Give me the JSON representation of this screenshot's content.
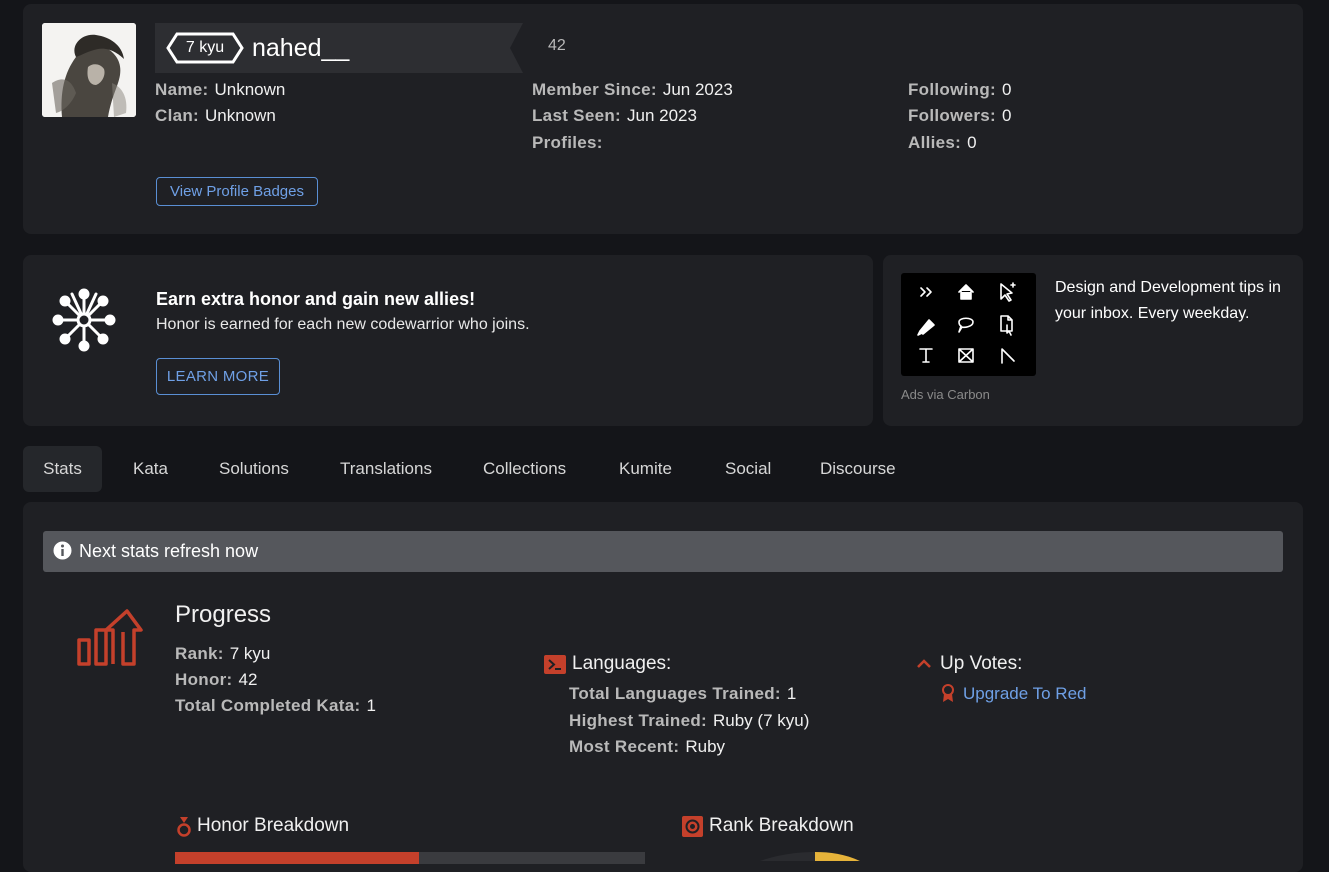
{
  "profile": {
    "rank": "7 kyu",
    "username": "nahed__",
    "honor": "42",
    "left": [
      {
        "label": "Name:",
        "value": "Unknown"
      },
      {
        "label": "Clan:",
        "value": "Unknown"
      }
    ],
    "middle": [
      {
        "label": "Member Since:",
        "value": "Jun 2023"
      },
      {
        "label": "Last Seen:",
        "value": "Jun 2023"
      },
      {
        "label": "Profiles:",
        "value": ""
      }
    ],
    "right": [
      {
        "label": "Following:",
        "value": "0"
      },
      {
        "label": "Followers:",
        "value": "0"
      },
      {
        "label": "Allies:",
        "value": "0"
      }
    ],
    "badges_button": "View Profile Badges"
  },
  "promo": {
    "title": "Earn extra honor and gain new allies!",
    "text": "Honor is earned for each new codewarrior who joins.",
    "button": "LEARN MORE",
    "icon": "network-icon"
  },
  "ad": {
    "text": "Design and Development tips in your inbox. Every weekday.",
    "via": "Ads via Carbon"
  },
  "tabs": [
    "Stats",
    "Kata",
    "Solutions",
    "Translations",
    "Collections",
    "Kumite",
    "Social",
    "Discourse"
  ],
  "stats": {
    "refresh": "Next stats refresh now",
    "progress": {
      "title": "Progress",
      "rows": [
        {
          "label": "Rank:",
          "value": "7 kyu"
        },
        {
          "label": "Honor:",
          "value": "42"
        },
        {
          "label": "Total Completed Kata:",
          "value": "1"
        }
      ]
    },
    "languages": {
      "title": "Languages:",
      "rows": [
        {
          "label": "Total Languages Trained:",
          "value": "1"
        },
        {
          "label": "Highest Trained:",
          "value": "Ruby (7 kyu)"
        },
        {
          "label": "Most Recent:",
          "value": "Ruby"
        }
      ]
    },
    "upvotes": {
      "title": "Up Votes:",
      "link": "Upgrade To Red"
    },
    "honor_breakdown": {
      "title": "Honor Breakdown",
      "fill_fraction": 0.52
    },
    "rank_breakdown": {
      "title": "Rank Breakdown"
    }
  },
  "colors": {
    "accent": "#c4402b",
    "link": "#6fa0e6",
    "background": "#141519",
    "panel": "#1f2024"
  }
}
